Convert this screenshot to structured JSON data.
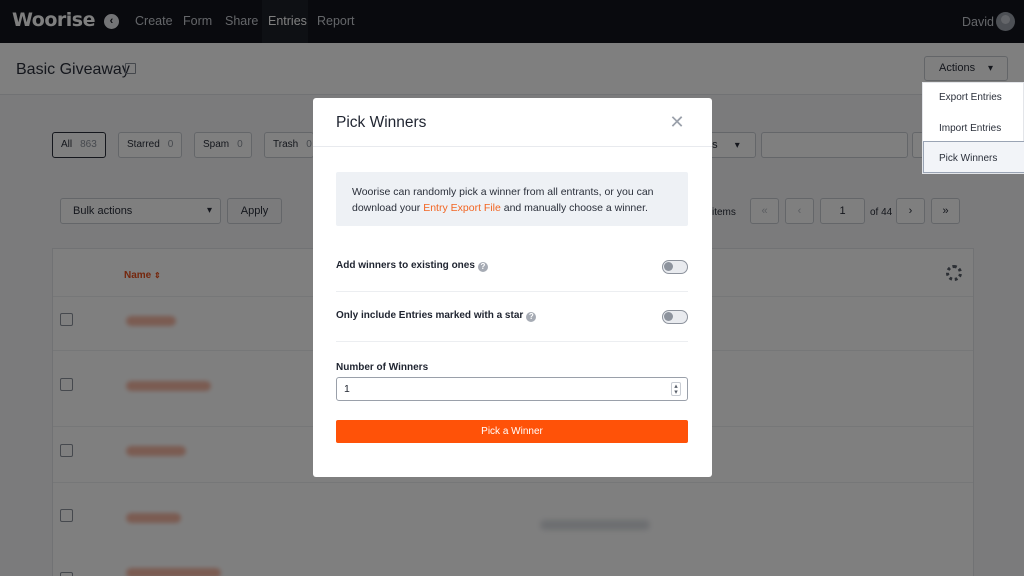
{
  "topbar": {
    "logo": "Woorise",
    "nav": [
      "Create",
      "Form",
      "Share",
      "Entries",
      "Report"
    ],
    "active_nav": "Entries",
    "user_name": "David"
  },
  "page": {
    "title": "Basic Giveaway",
    "actions_label": "Actions",
    "actions_menu": [
      "Export Entries",
      "Import Entries",
      "Pick Winners"
    ],
    "selected_action": "Pick Winners"
  },
  "background": {
    "tabs": [
      {
        "label": "All",
        "count": "863"
      },
      {
        "label": "Starred",
        "count": "0"
      },
      {
        "label": "Spam",
        "count": "0"
      },
      {
        "label": "Trash",
        "count": "0"
      }
    ],
    "filter_partial": "ns",
    "bulk_actions": "Bulk actions",
    "apply": "Apply",
    "items_partial": "items",
    "page_current": "1",
    "page_total": "of 44",
    "prev_first": "«",
    "prev": "‹",
    "next": "›",
    "next_last": "»",
    "column_name": "Name"
  },
  "modal": {
    "title": "Pick Winners",
    "info_before": "Woorise can randomly pick a winner from all entrants, or you can download your ",
    "info_link": "Entry Export File",
    "info_after": " and manually choose a winner.",
    "option_add_existing": "Add winners to existing ones",
    "option_starred_only": "Only include Entries marked with a star",
    "add_existing_enabled": false,
    "starred_only_enabled": false,
    "number_label": "Number of Winners",
    "number_value": "1",
    "pick_button": "Pick a Winner"
  },
  "colors": {
    "accent": "#ff5208",
    "link": "#f26522",
    "topbar": "#12151c"
  }
}
